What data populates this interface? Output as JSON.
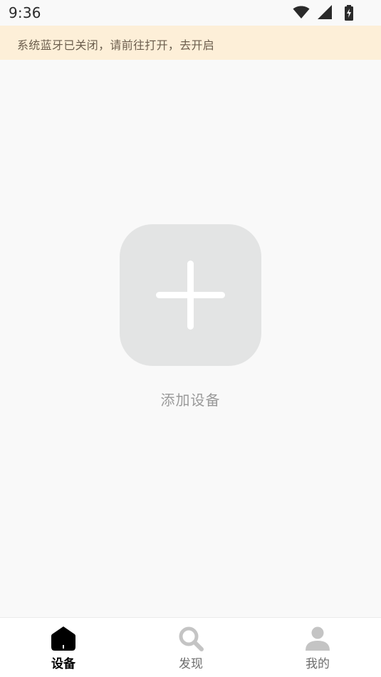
{
  "status_bar": {
    "time": "9:36",
    "icons": [
      "wifi-icon",
      "cellular-signal-icon",
      "battery-charging-icon"
    ]
  },
  "banner": {
    "text": "系统蓝牙已关闭，请前往打开，去开启",
    "background": "#fdefd8",
    "text_color": "#6b5e4d"
  },
  "main": {
    "add_device_label": "添加设备",
    "add_icon": "plus-icon",
    "tile_color": "#e3e4e4"
  },
  "bottom_nav": {
    "items": [
      {
        "label": "设备",
        "icon": "home-icon",
        "active": true
      },
      {
        "label": "发现",
        "icon": "search-icon",
        "active": false
      },
      {
        "label": "我的",
        "icon": "user-icon",
        "active": false
      }
    ],
    "active_color": "#000000",
    "inactive_color": "#c4c4c4"
  }
}
